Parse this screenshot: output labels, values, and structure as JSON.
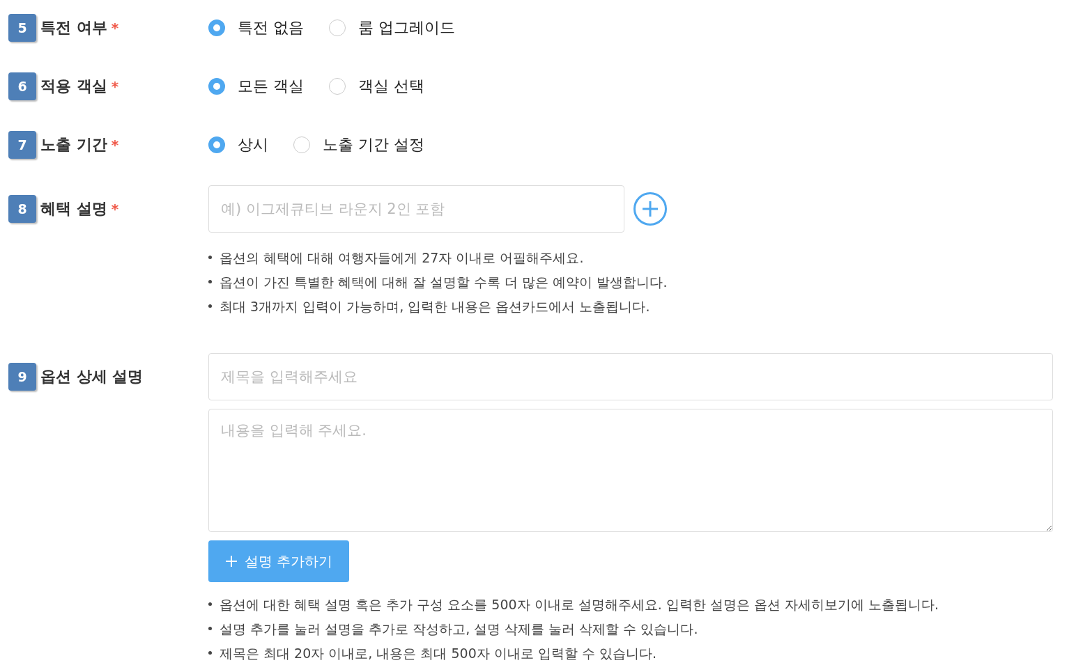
{
  "sections": [
    {
      "kind": "radio",
      "number": "5",
      "label": "특전 여부",
      "required_mark": "*",
      "options": [
        {
          "label": "특전 없음",
          "selected": true
        },
        {
          "label": "룸 업그레이드",
          "selected": false
        }
      ]
    },
    {
      "kind": "radio",
      "number": "6",
      "label": "적용 객실",
      "required_mark": "*",
      "options": [
        {
          "label": "모든 객실",
          "selected": true
        },
        {
          "label": "객실 선택",
          "selected": false
        }
      ]
    },
    {
      "kind": "radio",
      "number": "7",
      "label": "노출 기간",
      "required_mark": "*",
      "options": [
        {
          "label": "상시",
          "selected": true
        },
        {
          "label": "노출 기간 설정",
          "selected": false
        }
      ]
    },
    {
      "kind": "benefit",
      "number": "8",
      "label": "혜택 설명",
      "required_mark": "*",
      "placeholder": "예) 이그제큐티브 라운지 2인 포함",
      "notes": [
        "옵션의 혜택에 대해 여행자들에게 27자 이내로 어필해주세요.",
        "옵션이 가진 특별한 혜택에 대해 잘 설명할 수록 더 많은 예약이 발생합니다.",
        "최대 3개까지 입력이 가능하며, 입력한 내용은 옵션카드에서 노출됩니다."
      ]
    },
    {
      "kind": "detail",
      "number": "9",
      "label": "옵션 상세 설명",
      "title_placeholder": "제목을 입력해주세요",
      "body_placeholder": "내용을 입력해 주세요.",
      "button": "설명 추가하기",
      "notes": [
        "옵션에 대한 혜택 설명 혹은 추가 구성 요소를 500자 이내로 설명해주세요. 입력한 설명은 옵션 자세히보기에 노출됩니다.",
        "설명 추가를 눌러 설명을 추가로 작성하고, 설명 삭제를 눌러 삭제할 수 있습니다.",
        "제목은 최대 20자 이내로, 내용은 최대 500자 이내로 입력할 수 있습니다."
      ]
    }
  ]
}
